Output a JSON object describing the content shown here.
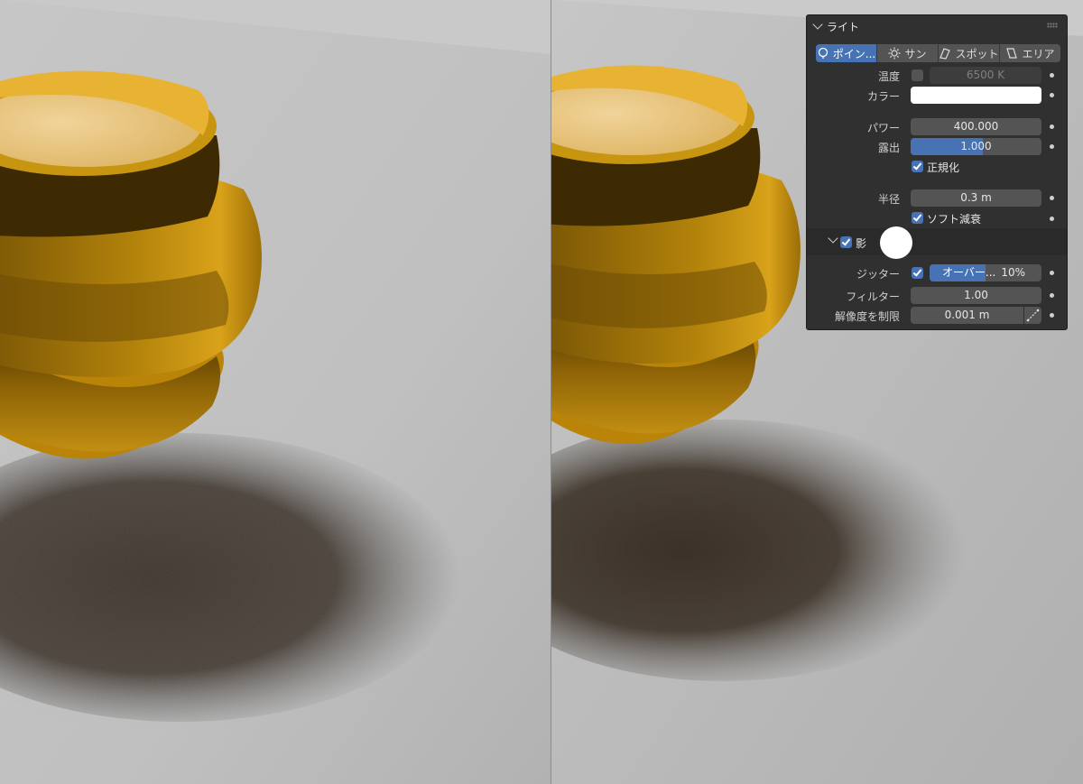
{
  "panel": {
    "title": "ライト",
    "light_types": [
      {
        "label": "ポイン...",
        "icon": "point-light-icon",
        "active": true
      },
      {
        "label": "サン",
        "icon": "sun-light-icon",
        "active": false
      },
      {
        "label": "スポット",
        "icon": "spot-light-icon",
        "active": false
      },
      {
        "label": "エリア",
        "icon": "area-light-icon",
        "active": false
      }
    ],
    "temperature": {
      "label": "温度",
      "value": "6500 K",
      "enabled": false
    },
    "color": {
      "label": "カラー",
      "value": "#ffffff"
    },
    "power": {
      "label": "パワー",
      "value": "400.000"
    },
    "exposure": {
      "label": "露出",
      "value": "1.000",
      "fill_fraction": 0.55
    },
    "normalize": {
      "label": "正規化",
      "checked": true
    },
    "radius": {
      "label": "半径",
      "value": "0.3 m"
    },
    "soft_falloff": {
      "label": "ソフト減衰",
      "checked": true
    },
    "shadow": {
      "label": "影",
      "checked": true,
      "jitter": {
        "label": "ジッター",
        "checked": true,
        "mode": "オーバー...",
        "value": "10%"
      },
      "filter": {
        "label": "フィルター",
        "value": "1.00"
      },
      "resolution_limit": {
        "label": "解像度を制限",
        "value": "0.001 m"
      }
    }
  },
  "colors": {
    "panel_bg": "#303030",
    "field_bg": "#545454",
    "accent": "#4772b3",
    "object_gold": "#d39b10",
    "floor": "#bdbdbd"
  }
}
